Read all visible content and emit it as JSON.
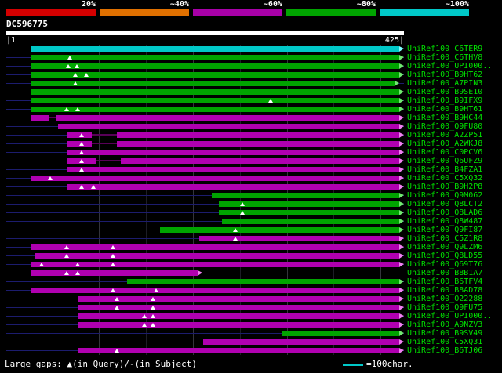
{
  "query": {
    "id": "DC596775",
    "left_tick": "|1",
    "right_tick": "425|",
    "length": 425
  },
  "legend": {
    "gaps_label": "Large gaps: ▲(in Query)/-(in Subject)",
    "scale_label": "=100char.",
    "scale_color": "#00c8c8"
  },
  "colors": {
    "cyan": "#00c8c8",
    "cyan_light": "#80ffff",
    "cyan_dark": "#006868",
    "green": "#00a400",
    "green_light": "#70e870",
    "green_dark": "#005400",
    "magenta": "#b000b0",
    "magenta_light": "#f080f0",
    "magenta_dark": "#580058",
    "baseline": "#1c1c6e",
    "grid_major": "#34343c",
    "grid_minor": "#1d1d26",
    "row_label": "#00e000"
  },
  "chart_data": {
    "type": "bar",
    "orientation": "horizontal",
    "title": "DC596775",
    "xlabel": "query position (characters)",
    "xlim": [
      1,
      425
    ],
    "grid": "vertical, every 50 characters",
    "legend_position": "top",
    "identity_scale": [
      {
        "label": "20%",
        "color": "#d40000"
      },
      {
        "label": "~40%",
        "color": "#e07000"
      },
      {
        "label": "~60%",
        "color": "#a800a8"
      },
      {
        "label": "~80%",
        "color": "#00a400"
      },
      {
        "label": "~100%",
        "color": "#00c8c8"
      }
    ],
    "rows": [
      {
        "label": "UniRef100_C6TER9",
        "color": "cyan",
        "segments": [
          [
            27,
            420
          ]
        ],
        "gaps": []
      },
      {
        "label": "UniRef100_C6THV8",
        "color": "green",
        "segments": [
          [
            27,
            420
          ]
        ],
        "gaps": [
          69
        ]
      },
      {
        "label": "UniRef100_UPI000..",
        "color": "green",
        "segments": [
          [
            27,
            420
          ]
        ],
        "gaps": [
          67,
          76
        ]
      },
      {
        "label": "UniRef100_B9HT62",
        "color": "green",
        "segments": [
          [
            27,
            420
          ]
        ],
        "gaps": [
          75,
          86
        ]
      },
      {
        "label": "UniRef100_A7PIN3",
        "color": "green",
        "segments": [
          [
            27,
            415
          ]
        ],
        "gaps": [
          75
        ]
      },
      {
        "label": "UniRef100_B9SE10",
        "color": "green",
        "segments": [
          [
            27,
            420
          ]
        ],
        "gaps": []
      },
      {
        "label": "UniRef100_B9IFX9",
        "color": "green",
        "segments": [
          [
            27,
            420
          ]
        ],
        "gaps": [
          283
        ]
      },
      {
        "label": "UniRef100_B9HT61",
        "color": "green",
        "segments": [
          [
            27,
            420
          ]
        ],
        "gaps": [
          65,
          77
        ]
      },
      {
        "label": "UniRef100_B9HC44",
        "color": "magenta",
        "segments": [
          [
            27,
            46
          ],
          [
            46,
            54,
            1
          ],
          [
            54,
            420
          ]
        ],
        "gaps": []
      },
      {
        "label": "UniRef100_Q9FU80",
        "color": "magenta",
        "segments": [
          [
            56,
            420
          ]
        ],
        "gaps": []
      },
      {
        "label": "UniRef100_A2ZP51",
        "color": "magenta",
        "segments": [
          [
            65,
            92
          ],
          [
            92,
            119,
            1
          ],
          [
            119,
            420
          ]
        ],
        "gaps": [
          81
        ]
      },
      {
        "label": "UniRef100_A2WKJ8",
        "color": "magenta",
        "segments": [
          [
            65,
            92
          ],
          [
            92,
            119,
            1
          ],
          [
            119,
            420
          ]
        ],
        "gaps": [
          81
        ]
      },
      {
        "label": "UniRef100_C0PCV6",
        "color": "magenta",
        "segments": [
          [
            65,
            420
          ]
        ],
        "gaps": [
          81
        ]
      },
      {
        "label": "UniRef100_Q6UFZ9",
        "color": "magenta",
        "segments": [
          [
            65,
            96
          ],
          [
            96,
            123,
            1
          ],
          [
            123,
            420
          ]
        ],
        "gaps": [
          81
        ]
      },
      {
        "label": "UniRef100_B4FZA1",
        "color": "magenta",
        "segments": [
          [
            65,
            420
          ]
        ],
        "gaps": [
          81
        ]
      },
      {
        "label": "UniRef100_C5XQ32",
        "color": "magenta",
        "segments": [
          [
            27,
            420
          ]
        ],
        "gaps": [
          48
        ]
      },
      {
        "label": "UniRef100_B9H2P8",
        "color": "magenta",
        "segments": [
          [
            65,
            420
          ]
        ],
        "gaps": [
          81,
          94
        ]
      },
      {
        "label": "UniRef100_Q9M062",
        "color": "green",
        "segments": [
          [
            220,
            420
          ]
        ],
        "gaps": []
      },
      {
        "label": "UniRef100_Q8LCT2",
        "color": "green",
        "segments": [
          [
            228,
            420
          ]
        ],
        "gaps": [
          253
        ]
      },
      {
        "label": "UniRef100_Q8LAD6",
        "color": "green",
        "segments": [
          [
            228,
            420
          ]
        ],
        "gaps": [
          253
        ]
      },
      {
        "label": "UniRef100_Q8W487",
        "color": "green",
        "segments": [
          [
            231,
            420
          ]
        ],
        "gaps": []
      },
      {
        "label": "UniRef100_Q9FI87",
        "color": "green",
        "segments": [
          [
            165,
            420
          ]
        ],
        "gaps": [
          245
        ]
      },
      {
        "label": "UniRef100_C5Z1R8",
        "color": "magenta",
        "segments": [
          [
            207,
            420
          ]
        ],
        "gaps": [
          245
        ]
      },
      {
        "label": "UniRef100_Q9LZM6",
        "color": "magenta",
        "segments": [
          [
            27,
            420
          ]
        ],
        "gaps": [
          65,
          115
        ]
      },
      {
        "label": "UniRef100_Q8LD55",
        "color": "magenta",
        "segments": [
          [
            31,
            420
          ]
        ],
        "gaps": [
          65,
          115
        ]
      },
      {
        "label": "UniRef100_Q69T76",
        "color": "magenta",
        "segments": [
          [
            27,
            420
          ]
        ],
        "gaps": [
          39,
          77,
          115
        ]
      },
      {
        "label": "UniRef100_B8B1A7",
        "color": "magenta",
        "segments": [
          [
            27,
            205
          ]
        ],
        "gaps": [
          65,
          77
        ]
      },
      {
        "label": "UniRef100_B6TFV4",
        "color": "green",
        "segments": [
          [
            130,
            420
          ]
        ],
        "gaps": []
      },
      {
        "label": "UniRef100_B8AD78",
        "color": "magenta",
        "segments": [
          [
            27,
            420
          ]
        ],
        "gaps": [
          115,
          161
        ]
      },
      {
        "label": "UniRef100_O22288",
        "color": "magenta",
        "segments": [
          [
            77,
            420
          ]
        ],
        "gaps": [
          119,
          157
        ]
      },
      {
        "label": "UniRef100_Q9FU75",
        "color": "magenta",
        "segments": [
          [
            77,
            420
          ]
        ],
        "gaps": [
          119,
          157
        ]
      },
      {
        "label": "UniRef100_UPI000..",
        "color": "magenta",
        "segments": [
          [
            77,
            420
          ]
        ],
        "gaps": [
          148,
          157
        ]
      },
      {
        "label": "UniRef100_A9NZV3",
        "color": "magenta",
        "segments": [
          [
            77,
            420
          ]
        ],
        "gaps": [
          148,
          157
        ]
      },
      {
        "label": "UniRef100_B9SV49",
        "color": "green",
        "segments": [
          [
            295,
            420
          ]
        ],
        "gaps": []
      },
      {
        "label": "UniRef100_C5XQ31",
        "color": "magenta",
        "segments": [
          [
            211,
            420
          ]
        ],
        "gaps": []
      },
      {
        "label": "UniRef100_B6TJ06",
        "color": "magenta",
        "segments": [
          [
            77,
            420
          ]
        ],
        "gaps": [
          119
        ]
      }
    ]
  }
}
